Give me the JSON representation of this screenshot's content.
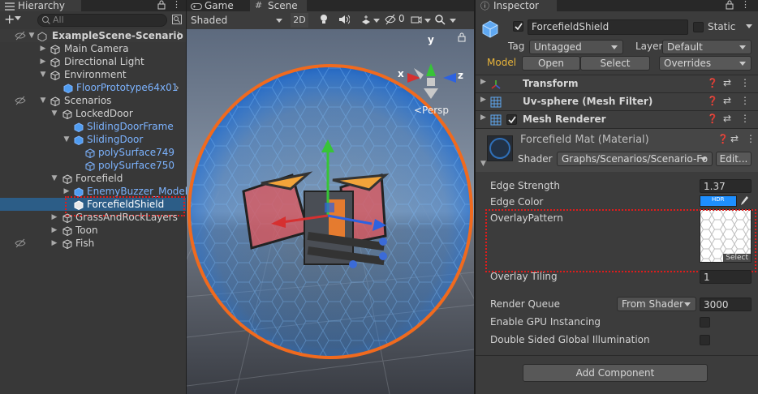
{
  "hierarchy": {
    "tab_label": "Hierarchy",
    "search_placeholder": "All",
    "add_label": "+",
    "rows": [
      {
        "label": "ExampleScene-Scenario",
        "bold": true
      },
      {
        "label": "Main Camera"
      },
      {
        "label": "Directional Light"
      },
      {
        "label": "Environment"
      },
      {
        "label": "FloorPrototype64x01",
        "prefab": true
      },
      {
        "label": "Scenarios"
      },
      {
        "label": "LockedDoor"
      },
      {
        "label": "SlidingDoorFrame",
        "prefab": true
      },
      {
        "label": "SlidingDoor",
        "prefab": true
      },
      {
        "label": "polySurface749",
        "prefab": true
      },
      {
        "label": "polySurface750",
        "prefab": true
      },
      {
        "label": "Forcefield"
      },
      {
        "label": "EnemyBuzzer_Model",
        "prefab": true
      },
      {
        "label": "ForcefieldShield",
        "selected": true
      },
      {
        "label": "GrassAndRockLayers"
      },
      {
        "label": "Toon"
      },
      {
        "label": "Fish"
      }
    ]
  },
  "scene": {
    "tab_game": "Game",
    "tab_scene": "Scene",
    "shading_mode": "Shaded",
    "mode_2d": "2D",
    "gizmo_count": "0",
    "persp_label": "<Persp",
    "axis_x": "x",
    "axis_y": "y",
    "axis_z": "z"
  },
  "inspector": {
    "tab_label": "Inspector",
    "object_name": "ForcefieldShield",
    "static_label": "Static",
    "tag_label": "Tag",
    "tag_value": "Untagged",
    "layer_label": "Layer",
    "layer_value": "Default",
    "model_label": "Model",
    "open_label": "Open",
    "select_label": "Select",
    "overrides_label": "Overrides",
    "components": [
      {
        "name": "Transform"
      },
      {
        "name": "Uv-sphere (Mesh Filter)"
      },
      {
        "name": "Mesh Renderer"
      }
    ],
    "material": {
      "name": "Forcefield Mat (Material)",
      "shader_label": "Shader",
      "shader_value": "Graphs/Scenarios/Scenario-Fo",
      "edit_label": "Edit..."
    },
    "properties": {
      "edge_strength_label": "Edge Strength",
      "edge_strength_value": "1.37",
      "edge_color_label": "Edge Color",
      "edge_color_hex": "#1e8fff",
      "overlay_pattern_label": "OverlayPattern",
      "texture_select_label": "Select",
      "overlay_tiling_label": "Overlay Tiling",
      "overlay_tiling_value": "1",
      "render_queue_label": "Render Queue",
      "render_queue_mode": "From Shader",
      "render_queue_value": "3000",
      "gpu_instancing_label": "Enable GPU Instancing",
      "double_sided_label": "Double Sided Global Illumination"
    },
    "add_component_label": "Add Component"
  },
  "colors": {
    "selection": "#2c5d87",
    "highlight": "#e01b1b",
    "model_label": "#e8b43a",
    "prefab_text": "#7cb3ff"
  }
}
